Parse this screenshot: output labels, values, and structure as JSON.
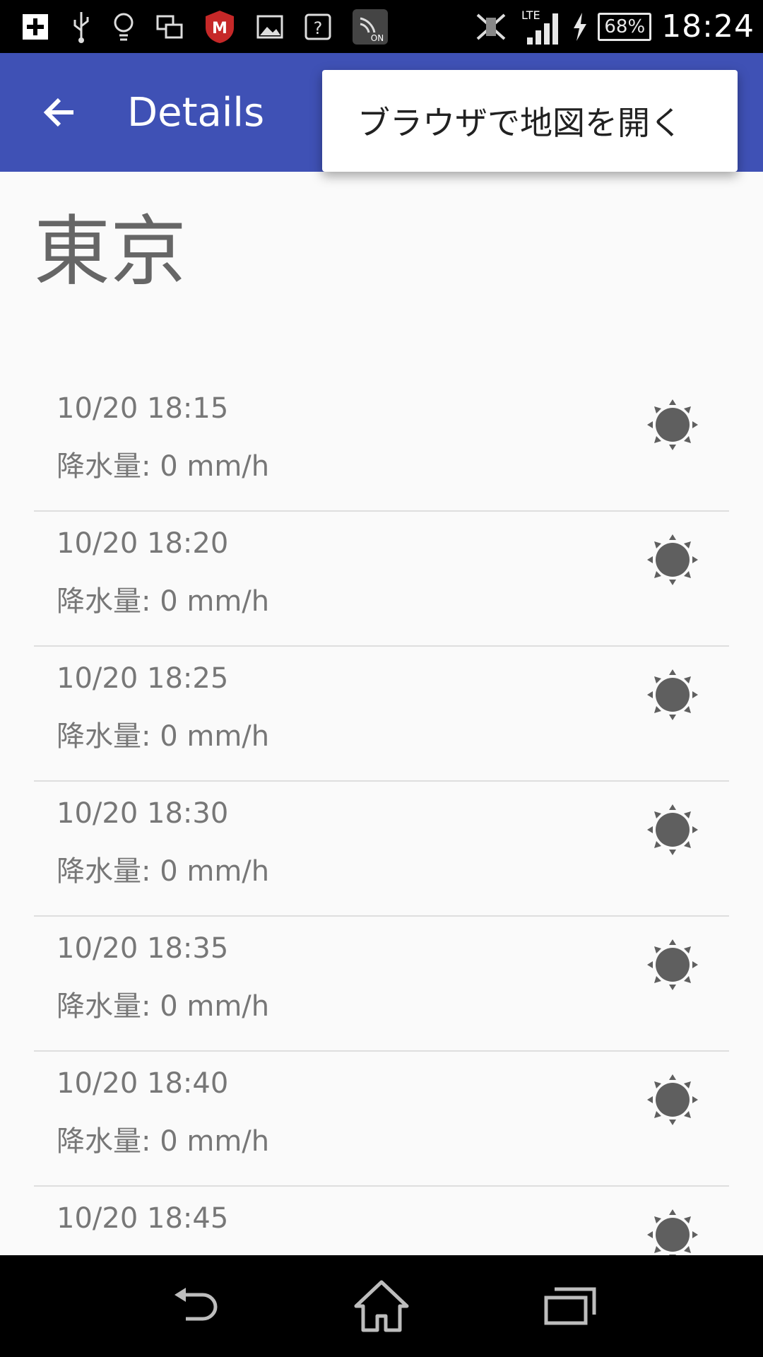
{
  "status_bar": {
    "time": "18:24",
    "battery": "68%",
    "network": "LTE",
    "icons": [
      "add-icon",
      "usb-icon",
      "bulb-icon",
      "screen-mirror-icon",
      "mcafee-icon",
      "image-icon",
      "help-icon",
      "nfc-on-icon",
      "vibrate-off-icon",
      "signal-icon",
      "charging-icon",
      "battery-icon"
    ]
  },
  "app_bar": {
    "title": "Details",
    "color": "#3f51b5"
  },
  "menu": {
    "items": [
      "ブラウザで地図を開く"
    ]
  },
  "city": "東京",
  "forecast": [
    {
      "time": "10/20 18:15",
      "precip": "降水量: 0 mm/h",
      "icon": "sun-icon"
    },
    {
      "time": "10/20 18:20",
      "precip": "降水量: 0 mm/h",
      "icon": "sun-icon"
    },
    {
      "time": "10/20 18:25",
      "precip": "降水量: 0 mm/h",
      "icon": "sun-icon"
    },
    {
      "time": "10/20 18:30",
      "precip": "降水量: 0 mm/h",
      "icon": "sun-icon"
    },
    {
      "time": "10/20 18:35",
      "precip": "降水量: 0 mm/h",
      "icon": "sun-icon"
    },
    {
      "time": "10/20 18:40",
      "precip": "降水量: 0 mm/h",
      "icon": "sun-icon"
    },
    {
      "time": "10/20 18:45",
      "precip": "",
      "icon": "sun-icon"
    }
  ],
  "nav_bar": {
    "icons": [
      "back-nav-icon",
      "home-nav-icon",
      "recents-nav-icon"
    ]
  }
}
